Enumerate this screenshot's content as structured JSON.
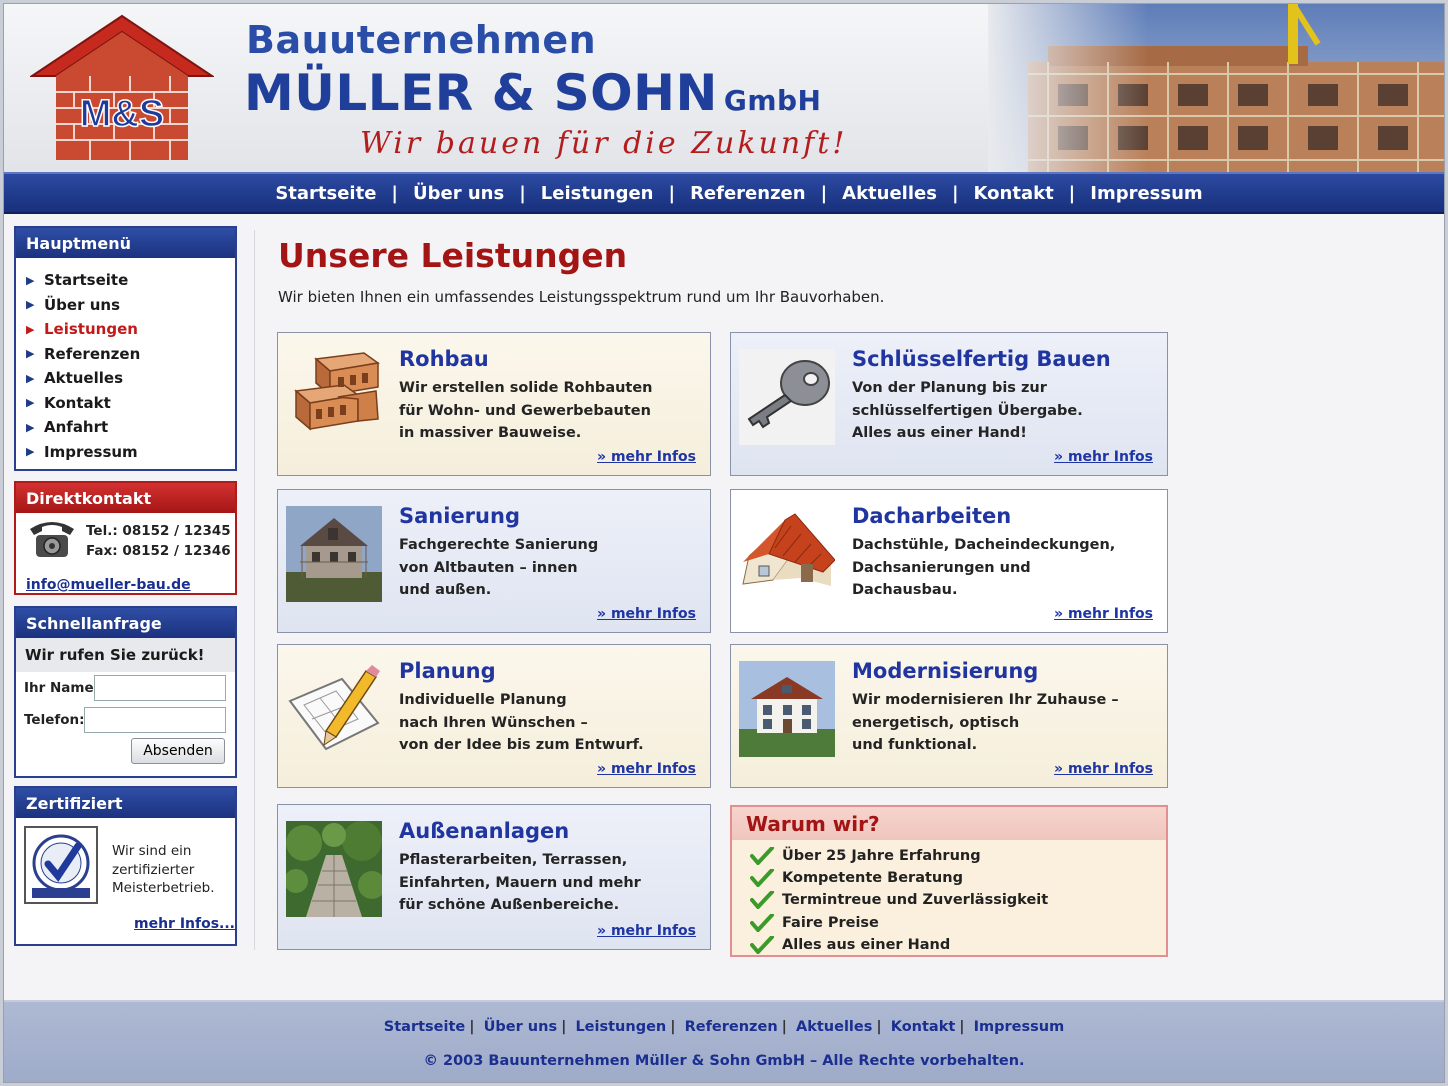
{
  "header": {
    "brand_line1": "Bauuternehmen",
    "brand_line2": "MÜLLER & SOHN",
    "brand_suffix": "GmbH",
    "slogan": "Wir bauen für die Zukunft!",
    "logo_text": "M&S"
  },
  "topnav": {
    "items": [
      "Startseite",
      "Über uns",
      "Leistungen",
      "Referenzen",
      "Aktuelles",
      "Kontakt",
      "Impressum"
    ],
    "separator": "|"
  },
  "sidebar": {
    "menu_title": "Hauptmenü",
    "menu_items": [
      "Startseite",
      "Über uns",
      "Leistungen",
      "Referenzen",
      "Aktuelles",
      "Kontakt",
      "Anfahrt",
      "Impressum"
    ],
    "active_item": "Leistungen",
    "contact": {
      "title": "Direktkontakt",
      "tel": "Tel.: 08152 / 12345",
      "fax": "Fax: 08152 / 12346",
      "email": "info@mueller-bau.de"
    },
    "quick": {
      "title": "Schnellanfrage",
      "subtitle": "Wir rufen Sie zurück!",
      "name_label": "Ihr Name:",
      "name_value": "",
      "phone_label": "Telefon:",
      "phone_value": "",
      "submit": "Absenden"
    },
    "cert": {
      "title": "Zertifiziert",
      "text": "Wir sind ein zertifizierter Meisterbetrieb.",
      "link": "mehr Infos..."
    }
  },
  "main": {
    "title": "Unsere Leistungen",
    "intro": "Wir bieten Ihnen ein umfassendes Leistungsspektrum rund um Ihr Bauvorhaben.",
    "more_label": "» mehr Infos",
    "services": [
      {
        "title": "Rohbau",
        "lines": [
          "Wir erstellen solide Rohbauten",
          "für Wohn- und Gewerbebauten",
          "in massiver Bauweise."
        ],
        "icon": "bricks-icon"
      },
      {
        "title": "Schlüsselfertig Bauen",
        "lines": [
          "Von der Planung bis zur",
          "schlüsselfertigen Übergabe.",
          "Alles aus einer Hand!"
        ],
        "icon": "key-icon"
      },
      {
        "title": "Sanierung",
        "lines": [
          "Fachgerechte Sanierung",
          "von Altbauten – innen",
          "und außen."
        ],
        "icon": "old-house-photo-icon"
      },
      {
        "title": "Dacharbeiten",
        "lines": [
          "Dachstühle, Dacheindeckungen,",
          "Dachsanierungen und",
          "Dachausbau."
        ],
        "icon": "roof-icon"
      },
      {
        "title": "Planung",
        "lines": [
          "Individuelle Planung",
          "nach Ihren Wünschen –",
          "von der Idee bis zum Entwurf."
        ],
        "icon": "blueprint-pencil-icon"
      },
      {
        "title": "Modernisierung",
        "lines": [
          "Wir modernisieren Ihr Zuhause –",
          "energetisch, optisch",
          "und funktional."
        ],
        "icon": "house-photo-icon"
      },
      {
        "title": "Außenanlagen",
        "lines": [
          "Pflasterarbeiten, Terrassen,",
          "Einfahrten, Mauern und mehr",
          "für schöne Außenbereiche."
        ],
        "icon": "garden-path-icon"
      }
    ],
    "why": {
      "title": "Warum wir?",
      "items": [
        "Über 25 Jahre Erfahrung",
        "Kompetente Beratung",
        "Termintreue und Zuverlässigkeit",
        "Faire Preise",
        "Alles aus einer Hand"
      ]
    }
  },
  "footer": {
    "links": [
      "Startseite",
      "Über uns",
      "Leistungen",
      "Referenzen",
      "Aktuelles",
      "Kontakt",
      "Impressum"
    ],
    "copyright": "© 2003 Bauunternehmen Müller & Sohn GmbH – Alle Rechte vorbehalten."
  },
  "colors": {
    "nav_blue": "#1f3a8f",
    "accent_red": "#a31414",
    "link_blue": "#1f35a4",
    "card_beige": "#f8f3e3",
    "card_blue": "#e6eaf4"
  }
}
